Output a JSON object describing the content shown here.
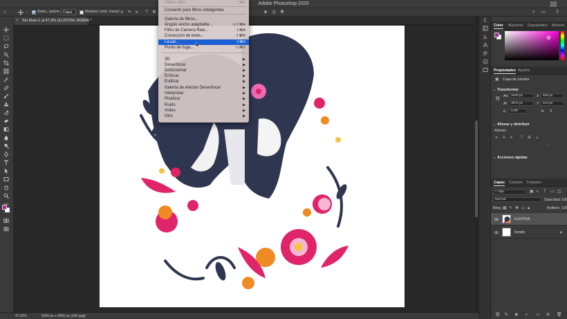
{
  "app": {
    "title": "Adobe Photoshop 2020"
  },
  "options_bar": {
    "auto_select_label": "Selec. autom.:",
    "auto_select_target": "Capa",
    "transform_controls_label": "Mostrar contr. transf."
  },
  "document": {
    "tab_title": "Sin título-1 al 47,9% (ILUSTRA, RGB/8) *",
    "tab_close": "×"
  },
  "status": {
    "zoom": "47,92%",
    "doc_size": "6000 px x 4000 px (300 ppp)"
  },
  "filter_menu": {
    "items": [
      {
        "label": "Último filtro",
        "shortcut": "^⌘F",
        "disabled": true
      },
      {
        "label": "Convertir para filtros inteligentes",
        "shortcut": ""
      },
      {
        "label": "Galería de filtros...",
        "shortcut": ""
      },
      {
        "label": "Ángulo ancho adaptable...",
        "shortcut": "⌥⇧⌘A"
      },
      {
        "label": "Filtro de Camera Raw...",
        "shortcut": "⇧⌘A"
      },
      {
        "label": "Corrección de lente...",
        "shortcut": "⇧⌘R"
      },
      {
        "label": "Licuar...",
        "shortcut": "⇧⌘X",
        "highlighted": true
      },
      {
        "label": "Punto de fuga...",
        "shortcut": "⌥⌘V"
      },
      {
        "label": "3D"
      },
      {
        "label": "Desenfocar"
      },
      {
        "label": "Distorsionar"
      },
      {
        "label": "Enfocar"
      },
      {
        "label": "Estilizar"
      },
      {
        "label": "Galería de efectos Desenfocar"
      },
      {
        "label": "Interpretar"
      },
      {
        "label": "Pixelizar"
      },
      {
        "label": "Ruido"
      },
      {
        "label": "Vídeo"
      },
      {
        "label": "Otro"
      }
    ],
    "submenu_arrow": "▶"
  },
  "color_panel": {
    "tabs": [
      "Color",
      "Muestras",
      "Degradados",
      "Motivos"
    ],
    "accent": "#b02a9a"
  },
  "properties_panel": {
    "tabs": [
      "Propiedades",
      "Ajustes"
    ],
    "layer_type": "Capa de píxeles",
    "transform_title": "Transformar",
    "an_label": "An",
    "an_value": "2640 px",
    "x_label": "X",
    "x_value": "529 px",
    "al_label": "Al",
    "al_value": "3672 px",
    "y_label": "Y",
    "y_value": "214 px",
    "angle_value": "0,00°",
    "align_title": "Alinear y distribuir",
    "align_label": "Alinear:",
    "quick_actions_title": "Acciones rápidas"
  },
  "layers_panel": {
    "tabs": [
      "Capas",
      "Canales",
      "Trazados"
    ],
    "filter_kind": "Tipo",
    "blend_mode": "Normal",
    "opacity_label": "Opacidad:",
    "opacity_value": "100",
    "lock_label": "Bloq.:",
    "fill_label": "Relleno:",
    "fill_value": "100",
    "layers": [
      {
        "name": "ILUSTRA",
        "selected": true
      },
      {
        "name": "Fondo",
        "selected": false
      }
    ]
  }
}
